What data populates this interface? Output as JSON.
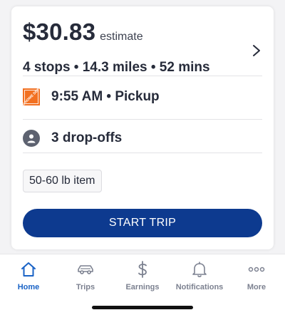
{
  "trip": {
    "price": "$30.83",
    "price_suffix": "estimate",
    "summary": "4 stops • 14.3 miles • 52 mins",
    "pickup": "9:55 AM • Pickup",
    "dropoffs": "3 drop-offs",
    "item_tag": "50-60 lb item",
    "start_label": "START TRIP",
    "store_logo_text": "THE HOME DEPOT"
  },
  "tabs": [
    {
      "label": "Home",
      "icon": "home-icon",
      "active": true
    },
    {
      "label": "Trips",
      "icon": "car-icon",
      "active": false
    },
    {
      "label": "Earnings",
      "icon": "dollar-icon",
      "active": false
    },
    {
      "label": "Notifications",
      "icon": "bell-icon",
      "active": false
    },
    {
      "label": "More",
      "icon": "more-dots-icon",
      "active": false
    }
  ],
  "colors": {
    "primary": "#0d3a8f",
    "active_tab": "#1a63c6",
    "inactive_tab": "#7c8190",
    "home_depot_orange": "#f27021"
  }
}
